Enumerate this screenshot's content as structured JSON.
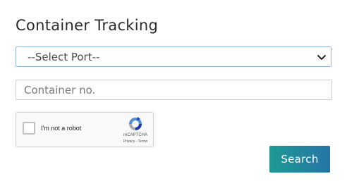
{
  "page": {
    "title": "Container Tracking"
  },
  "port_select": {
    "selected": "--Select Port--"
  },
  "container_input": {
    "placeholder": "Container no."
  },
  "recaptcha": {
    "label": "I'm not a robot",
    "brand": "reCAPTCHA",
    "links": "Privacy - Terms"
  },
  "actions": {
    "search_label": "Search"
  },
  "colors": {
    "button_gradient_start": "#1e9a93",
    "button_gradient_end": "#2574a8",
    "select_border": "#8fb6e6"
  }
}
